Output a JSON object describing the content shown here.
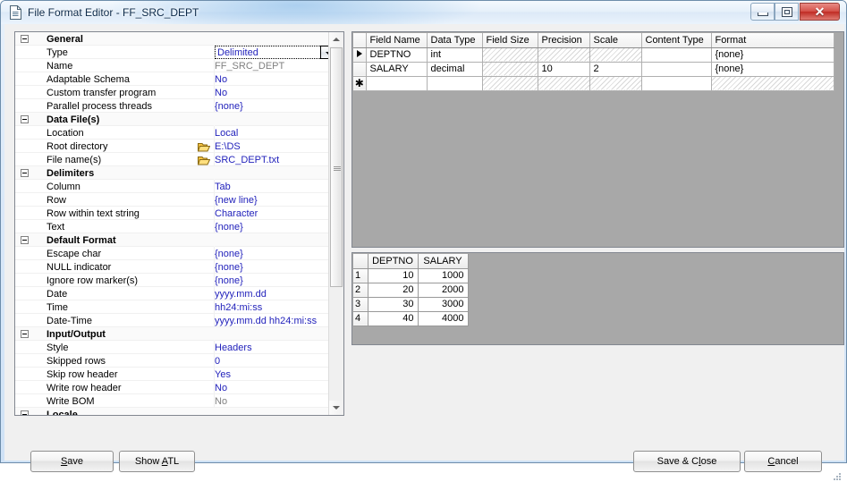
{
  "window": {
    "title": "File Format Editor - FF_SRC_DEPT",
    "icon": "document-icon",
    "minimize_label": "Minimize",
    "maximize_label": "Restore",
    "close_label": "Close"
  },
  "property_grid": {
    "rows": [
      {
        "kind": "category",
        "label": "General"
      },
      {
        "kind": "editor",
        "label": "Type",
        "value": "Delimited"
      },
      {
        "kind": "prop",
        "label": "Name",
        "value": "FF_SRC_DEPT",
        "style": "gray"
      },
      {
        "kind": "prop",
        "label": "Adaptable Schema",
        "value": "No"
      },
      {
        "kind": "prop",
        "label": "Custom transfer program",
        "value": "No"
      },
      {
        "kind": "prop",
        "label": "Parallel process threads",
        "value": "{none}"
      },
      {
        "kind": "category",
        "label": "Data File(s)"
      },
      {
        "kind": "prop",
        "label": "Location",
        "value": "Local"
      },
      {
        "kind": "prop",
        "label": "Root directory",
        "value": "E:\\DS",
        "icon": "folder-icon"
      },
      {
        "kind": "prop",
        "label": "File name(s)",
        "value": "SRC_DEPT.txt",
        "icon": "folder-icon"
      },
      {
        "kind": "category",
        "label": "Delimiters"
      },
      {
        "kind": "prop",
        "label": "Column",
        "value": "Tab"
      },
      {
        "kind": "prop",
        "label": "Row",
        "value": "{new line}"
      },
      {
        "kind": "prop",
        "label": "Row within text string",
        "value": "Character"
      },
      {
        "kind": "prop",
        "label": "Text",
        "value": "{none}"
      },
      {
        "kind": "category",
        "label": "Default Format"
      },
      {
        "kind": "prop",
        "label": "Escape char",
        "value": "{none}"
      },
      {
        "kind": "prop",
        "label": "NULL indicator",
        "value": "{none}"
      },
      {
        "kind": "prop",
        "label": "Ignore row marker(s)",
        "value": "{none}"
      },
      {
        "kind": "prop",
        "label": "Date",
        "value": "yyyy.mm.dd"
      },
      {
        "kind": "prop",
        "label": "Time",
        "value": "hh24:mi:ss"
      },
      {
        "kind": "prop",
        "label": "Date-Time",
        "value": "yyyy.mm.dd hh24:mi:ss"
      },
      {
        "kind": "category",
        "label": "Input/Output"
      },
      {
        "kind": "prop",
        "label": "Style",
        "value": "Headers"
      },
      {
        "kind": "prop",
        "label": "Skipped rows",
        "value": "0"
      },
      {
        "kind": "prop",
        "label": "Skip row header",
        "value": "Yes"
      },
      {
        "kind": "prop",
        "label": "Write row header",
        "value": "No"
      },
      {
        "kind": "prop",
        "label": "Write BOM",
        "value": "No",
        "style": "gray"
      },
      {
        "kind": "category",
        "label": "Locale"
      }
    ]
  },
  "field_table": {
    "columns": [
      "Field Name",
      "Data Type",
      "Field Size",
      "Precision",
      "Scale",
      "Content Type",
      "Format"
    ],
    "rows": [
      {
        "marker": "current",
        "cells": [
          "DEPTNO",
          "int",
          "",
          "",
          "",
          "",
          "{none}"
        ],
        "disabled": [
          false,
          false,
          true,
          true,
          true,
          false,
          false
        ]
      },
      {
        "marker": "",
        "cells": [
          "SALARY",
          "decimal",
          "",
          "10",
          "2",
          "",
          "{none}"
        ],
        "disabled": [
          false,
          false,
          true,
          false,
          false,
          false,
          false
        ]
      },
      {
        "marker": "new",
        "cells": [
          "",
          "",
          "",
          "",
          "",
          "",
          ""
        ],
        "disabled": [
          false,
          false,
          true,
          true,
          true,
          false,
          true
        ]
      }
    ]
  },
  "preview_table": {
    "columns": [
      "DEPTNO",
      "SALARY"
    ],
    "rows": [
      {
        "index": "1",
        "values": [
          "10",
          "1000"
        ]
      },
      {
        "index": "2",
        "values": [
          "20",
          "2000"
        ]
      },
      {
        "index": "3",
        "values": [
          "30",
          "3000"
        ]
      },
      {
        "index": "4",
        "values": [
          "40",
          "4000"
        ]
      }
    ]
  },
  "buttons": {
    "save": {
      "pre": "S",
      "mn": "",
      "post": "ave",
      "full": "Save"
    },
    "show_atl": {
      "full": "Show ATL"
    },
    "save_close": {
      "full": "Save & Close"
    },
    "cancel": {
      "full": "Cancel"
    }
  },
  "colors": {
    "value_text": "#2222bb",
    "grid_background": "#a8a8a8",
    "close_button": "#bf2b24"
  }
}
